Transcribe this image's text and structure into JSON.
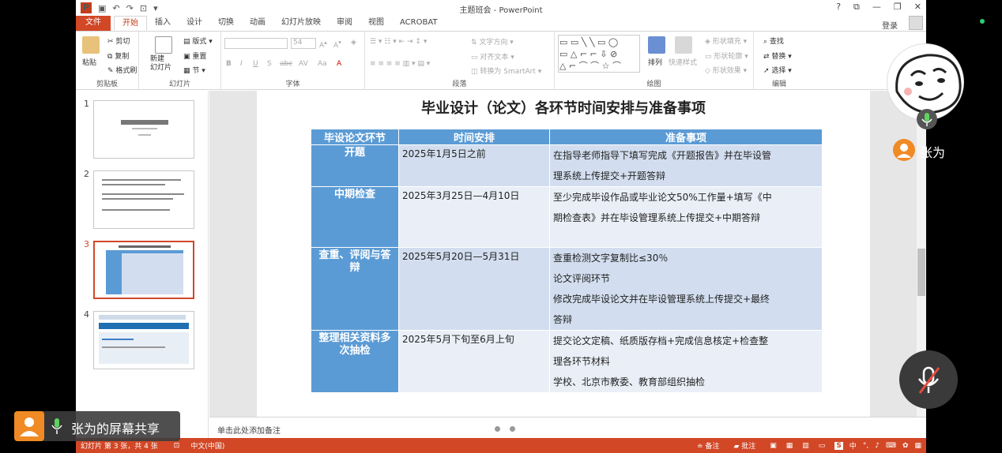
{
  "app": {
    "title": "主题班会 - PowerPoint",
    "quick_access": [
      "↶",
      "↷",
      "⊡"
    ],
    "window_controls": [
      "?",
      "⧉",
      "—",
      "❐",
      "✕"
    ],
    "login": "登录"
  },
  "tabs": [
    "文件",
    "开始",
    "插入",
    "设计",
    "切换",
    "动画",
    "幻灯片放映",
    "审阅",
    "视图",
    "ACROBAT"
  ],
  "ribbon": {
    "clipboard": {
      "label": "剪贴板",
      "paste": "粘贴",
      "cut": "剪切",
      "copy": "复制",
      "format_painter": "格式刷"
    },
    "slides": {
      "label": "幻灯片",
      "new_slide": "新建\n幻灯片",
      "layout": "版式",
      "reset": "重置",
      "section": "节"
    },
    "font": {
      "label": "字体",
      "font_size": "54",
      "buttons": [
        "B",
        "I",
        "U",
        "S",
        "abc",
        "AV",
        "Aa",
        "A"
      ]
    },
    "paragraph": {
      "label": "段落",
      "text_direction": "文字方向",
      "align_text": "对齐文本",
      "smartart": "转换为 SmartArt"
    },
    "drawing": {
      "label": "绘图",
      "arrange": "排列",
      "quick_styles": "快速样式",
      "shape_fill": "形状填充",
      "shape_outline": "形状轮廓",
      "shape_effects": "形状效果"
    },
    "editing": {
      "label": "编辑",
      "find": "查找",
      "replace": "替换",
      "select": "选择"
    }
  },
  "thumbnails": [
    {
      "num": "1",
      "selected": false
    },
    {
      "num": "2",
      "selected": false
    },
    {
      "num": "3",
      "selected": true
    },
    {
      "num": "4",
      "selected": false
    }
  ],
  "slide": {
    "title": "毕业设计（论文）各环节时间安排与准备事项",
    "headers": [
      "毕设论文环节",
      "时间安排",
      "准备事项"
    ],
    "rows": [
      {
        "stage": "开题",
        "time": "2025年1月5日之前",
        "prep": [
          "在指导老师指导下填写完成《开题报告》并在毕设管",
          "理系统上传提交+开题答辩"
        ]
      },
      {
        "stage": "中期检查",
        "time": "2025年3月25日—4月10日",
        "prep": [
          "至少完成毕设作品或毕业论文50%工作量+填写《中",
          "期检查表》并在毕设管理系统上传提交+中期答辩"
        ]
      },
      {
        "stage": "查重、评阅与答辩",
        "time": "2025年5月20日—5月31日",
        "prep": [
          "查重检测文字复制比≤30％",
          "论文评阅环节",
          "修改完成毕设论文并在毕设管理系统上传提交+最终",
          "答辩"
        ]
      },
      {
        "stage": "整理相关资料多次抽检",
        "time": "2025年5月下旬至6月上旬",
        "prep": [
          "提交论文定稿、纸质版存档+完成信息核定+检查整",
          "理各环节材料",
          "学校、北京市教委、教育部组织抽检"
        ]
      }
    ]
  },
  "notes": {
    "placeholder": "单击此处添加备注"
  },
  "status": {
    "slide_info": "幻灯片 第 3 张，共 4 张",
    "language": "中文(中国)",
    "notes_btn": "备注",
    "comments_btn": "批注",
    "ime_text": "中"
  },
  "overlay": {
    "presenter_name": "张为",
    "share_label": "张为的屏幕共享"
  },
  "colors": {
    "accent": "#d24726",
    "table_header": "#5b9bd5",
    "row_odd": "#d2deef",
    "row_even": "#eaeff7"
  }
}
